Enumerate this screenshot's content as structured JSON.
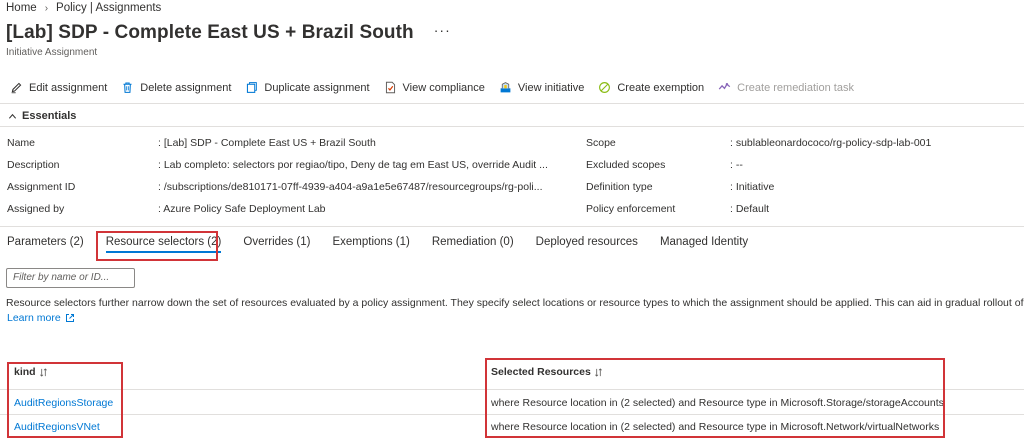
{
  "breadcrumb": {
    "home": "Home",
    "sep": "›",
    "current": "Policy | Assignments"
  },
  "header": {
    "title": "[Lab] SDP - Complete East US + Brazil South",
    "more": "···",
    "subtitle": "Initiative Assignment"
  },
  "toolbar": {
    "edit": "Edit assignment",
    "delete": "Delete assignment",
    "duplicate": "Duplicate assignment",
    "compliance": "View compliance",
    "initiative": "View initiative",
    "exemption": "Create exemption",
    "remediation": "Create remediation task"
  },
  "essentials": {
    "heading": "Essentials",
    "left": [
      {
        "label": "Name",
        "value": ": [Lab] SDP - Complete East US + Brazil South"
      },
      {
        "label": "Description",
        "value": ": Lab completo: selectors por regiao/tipo, Deny de tag em East US, override Audit ..."
      },
      {
        "label": "Assignment ID",
        "value": ": /subscriptions/de810171-07ff-4939-a404-a9a1e5e67487/resourcegroups/rg-poli..."
      },
      {
        "label": "Assigned by",
        "value": ": Azure Policy Safe Deployment Lab"
      }
    ],
    "right": [
      {
        "label": "Scope",
        "value": ": sublableonardococo/rg-policy-sdp-lab-001"
      },
      {
        "label": "Excluded scopes",
        "value": ": --"
      },
      {
        "label": "Definition type",
        "value": ": Initiative"
      },
      {
        "label": "Policy enforcement",
        "value": ": Default"
      }
    ]
  },
  "tabs": [
    "Parameters (2)",
    "Resource selectors (2)",
    "Overrides (1)",
    "Exemptions (1)",
    "Remediation (0)",
    "Deployed resources",
    "Managed Identity"
  ],
  "filter": {
    "placeholder": "Filter by name or ID..."
  },
  "description": "Resource selectors further narrow down the set of resources evaluated by a policy assignment. They specify select locations or resource types to which the assignment should be applied. This can aid in gradual rollout of the po",
  "learn_more": "Learn more",
  "table": {
    "headers": [
      "kind",
      "Selected Resources"
    ],
    "rows": [
      {
        "kind": "AuditRegionsStorage",
        "resources": "where Resource location in (2 selected) and Resource type in Microsoft.Storage/storageAccounts"
      },
      {
        "kind": "AuditRegionsVNet",
        "resources": "where Resource location in (2 selected) and Resource type in Microsoft.Network/virtualNetworks"
      }
    ]
  },
  "colors": {
    "accent": "#0078d4",
    "highlight": "#d13438",
    "text": "#323130"
  }
}
